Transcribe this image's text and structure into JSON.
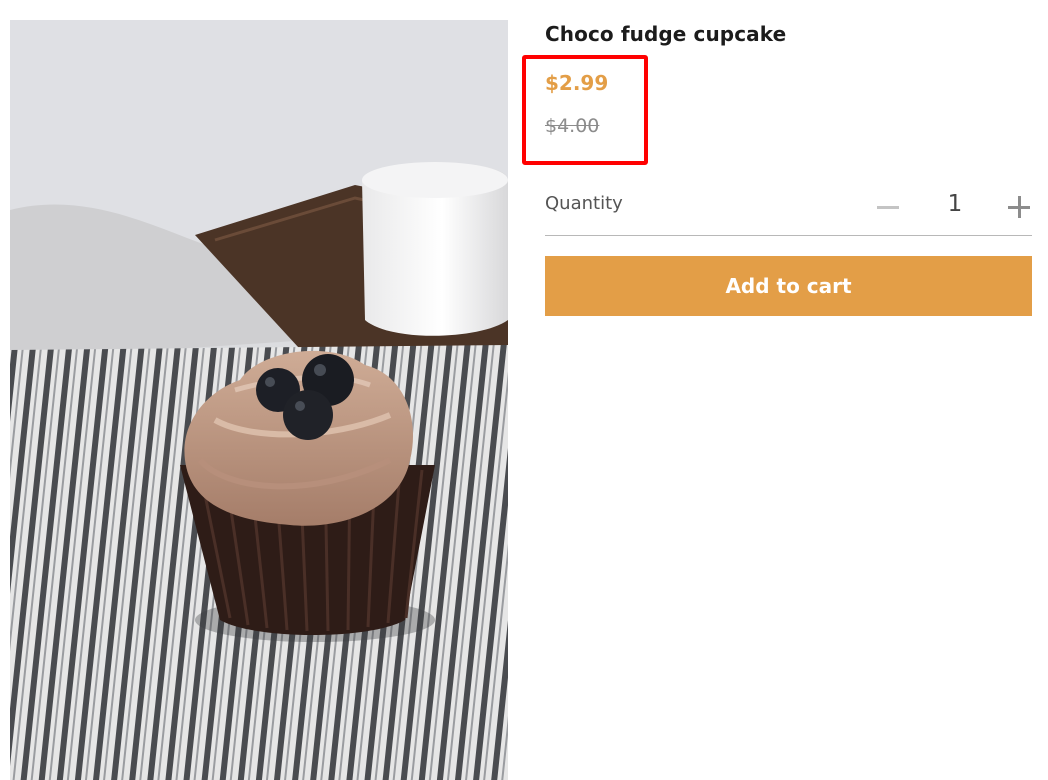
{
  "product": {
    "image_label": "Chocolate cupcake with blueberries on striped cloth",
    "title": "Choco fudge cupcake",
    "price_current": "$2.99",
    "price_original": "$4.00"
  },
  "quantity": {
    "label": "Quantity",
    "value": "1",
    "decrement_icon": "minus-icon",
    "increment_icon": "plus-icon"
  },
  "actions": {
    "add_to_cart_label": "Add to cart"
  },
  "colors": {
    "accent": "#e39e47",
    "highlight_border": "#ff0000",
    "old_price": "#8c8c8c",
    "title": "#1c1c1c"
  }
}
